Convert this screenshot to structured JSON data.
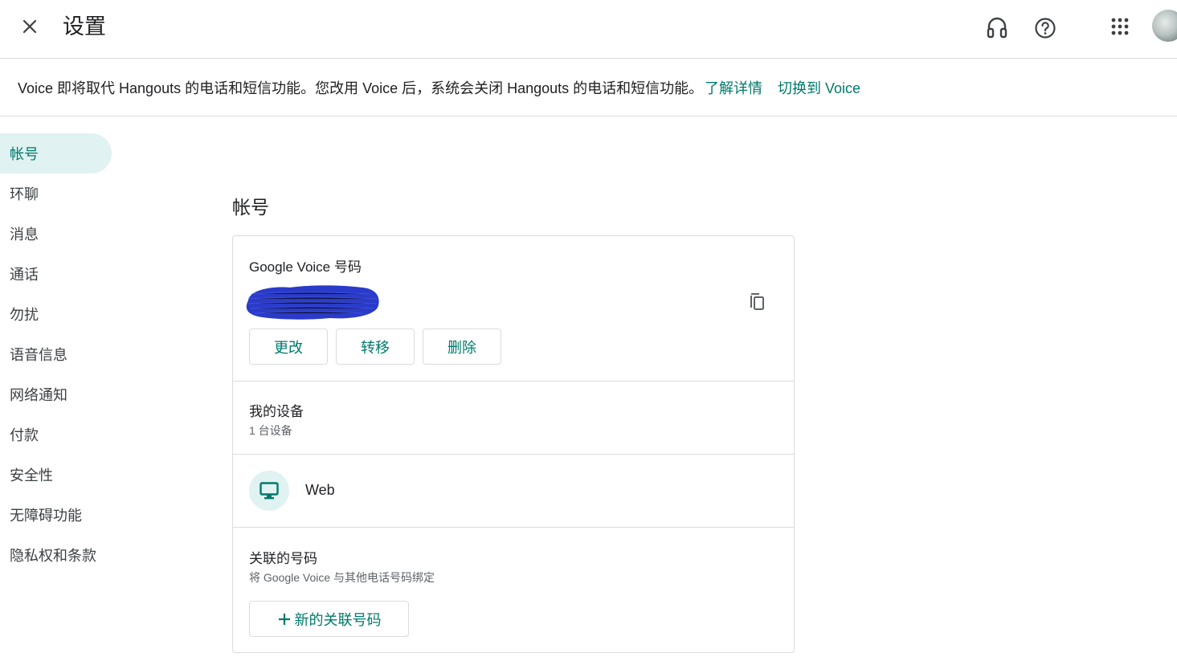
{
  "header": {
    "title": "设置",
    "icons": [
      "close-icon",
      "headset-icon",
      "help-icon",
      "apps-grid-icon",
      "avatar"
    ]
  },
  "banner": {
    "text": "Voice 即将取代 Hangouts 的电话和短信功能。您改用 Voice 后，系统会关闭 Hangouts 的电话和短信功能。",
    "learn_more": "了解详情",
    "switch": "切换到 Voice"
  },
  "sidebar": {
    "items": [
      {
        "label": "帐号",
        "active": true
      },
      {
        "label": "环聊"
      },
      {
        "label": "消息"
      },
      {
        "label": "通话"
      },
      {
        "label": "勿扰"
      },
      {
        "label": "语音信息"
      },
      {
        "label": "网络通知"
      },
      {
        "label": "付款"
      },
      {
        "label": "安全性"
      },
      {
        "label": "无障碍功能"
      },
      {
        "label": "隐私权和条款"
      }
    ]
  },
  "main": {
    "section_title": "帐号",
    "gv_number": {
      "label": "Google Voice 号码",
      "buttons": {
        "change": "更改",
        "transfer": "转移",
        "delete": "删除"
      }
    },
    "devices": {
      "label": "我的设备",
      "count": "1 台设备",
      "items": [
        {
          "name": "Web",
          "icon": "monitor-icon"
        }
      ]
    },
    "linked": {
      "label": "关联的号码",
      "sub": "将 Google Voice 与其他电话号码绑定",
      "add_button": "新的关联号码"
    }
  },
  "colors": {
    "accent": "#00796b",
    "active_bg": "#e0f2f1",
    "border": "#dadce0",
    "redaction": "#2a3bc9"
  }
}
